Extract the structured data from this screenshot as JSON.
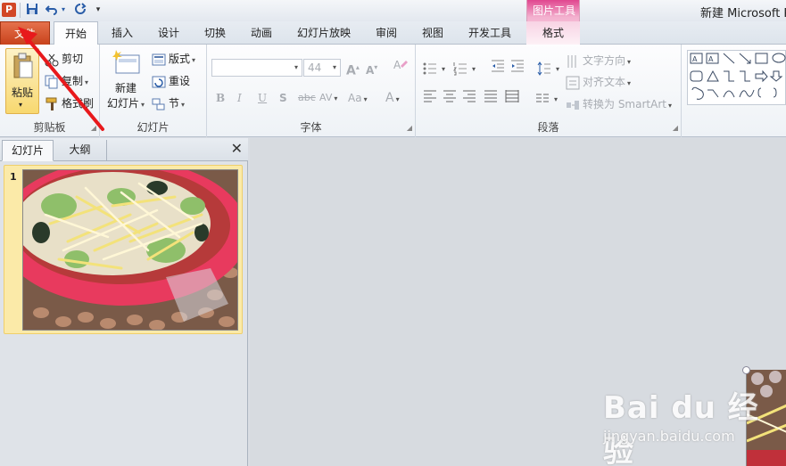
{
  "window": {
    "title": "新建 Microsoft P",
    "app_icon_letter": "P",
    "contextual_group": "图片工具"
  },
  "qat": {
    "save_icon": "save-icon",
    "undo_icon": "undo-icon",
    "redo_icon": "redo-icon",
    "customize_icon": "customize-qat-icon"
  },
  "tabs": [
    {
      "label": "文件"
    },
    {
      "label": "开始"
    },
    {
      "label": "插入"
    },
    {
      "label": "设计"
    },
    {
      "label": "切换"
    },
    {
      "label": "动画"
    },
    {
      "label": "幻灯片放映"
    },
    {
      "label": "审阅"
    },
    {
      "label": "视图"
    },
    {
      "label": "开发工具"
    },
    {
      "label": "格式"
    }
  ],
  "ribbon": {
    "clipboard": {
      "label": "剪贴板",
      "paste": "粘贴",
      "cut": "剪切",
      "copy": "复制",
      "format_painter": "格式刷"
    },
    "slides": {
      "label": "幻灯片",
      "new_slide_line1": "新建",
      "new_slide_line2": "幻灯片",
      "layout": "版式",
      "reset": "重设",
      "section": "节"
    },
    "font": {
      "label": "字体",
      "font_size": "44",
      "bold": "B",
      "italic": "I",
      "underline": "U",
      "shadow": "S",
      "strike": "abc",
      "spacing": "AV",
      "case": "Aa",
      "color": "A",
      "grow": "A",
      "shrink": "A"
    },
    "paragraph": {
      "label": "段落",
      "text_direction": "文字方向",
      "align_text": "对齐文本",
      "convert_smartart": "转换为 SmartArt"
    }
  },
  "leftpane": {
    "tab_slides": "幻灯片",
    "tab_outline": "大纲",
    "close": "✕",
    "slide_number": "1"
  },
  "watermark": {
    "logo": "Bai du 经验",
    "url": "jingyan.baidu.com"
  },
  "colors": {
    "file_tab": "#c8421b",
    "arrow": "#e8191c",
    "selection": "#fbeaa8"
  }
}
